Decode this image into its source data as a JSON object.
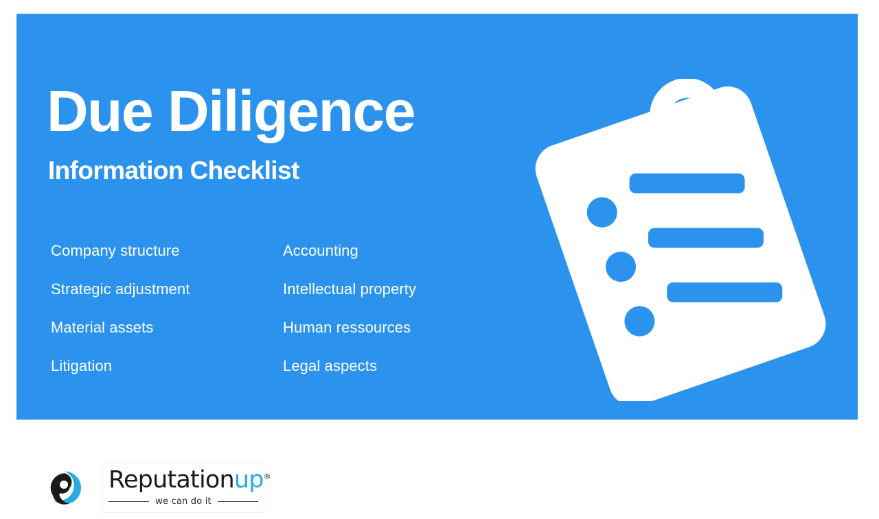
{
  "slide": {
    "background_color": "#ffffff",
    "panel_color": "#2b93ed",
    "accent_cyan": "#29abe2",
    "text_color": "#ffffff"
  },
  "hero": {
    "title": "Due Diligence",
    "subtitle": "Information Checklist"
  },
  "checklist": {
    "left_column": [
      "Company structure",
      "Strategic adjustment",
      "Material assets",
      "Litigation"
    ],
    "right_column": [
      "Accounting",
      "Intellectual property",
      "Human ressources",
      "Legal aspects"
    ]
  },
  "illustration": {
    "name": "clipboard-checklist-icon",
    "fill": "#ffffff",
    "detail_fill": "#2b93ed"
  },
  "footer": {
    "logo": {
      "mark_name": "reputationup-circle-mark",
      "word_main": "Reputation",
      "word_accent": "up",
      "registered_mark": "®",
      "tagline": "we can do it"
    }
  }
}
